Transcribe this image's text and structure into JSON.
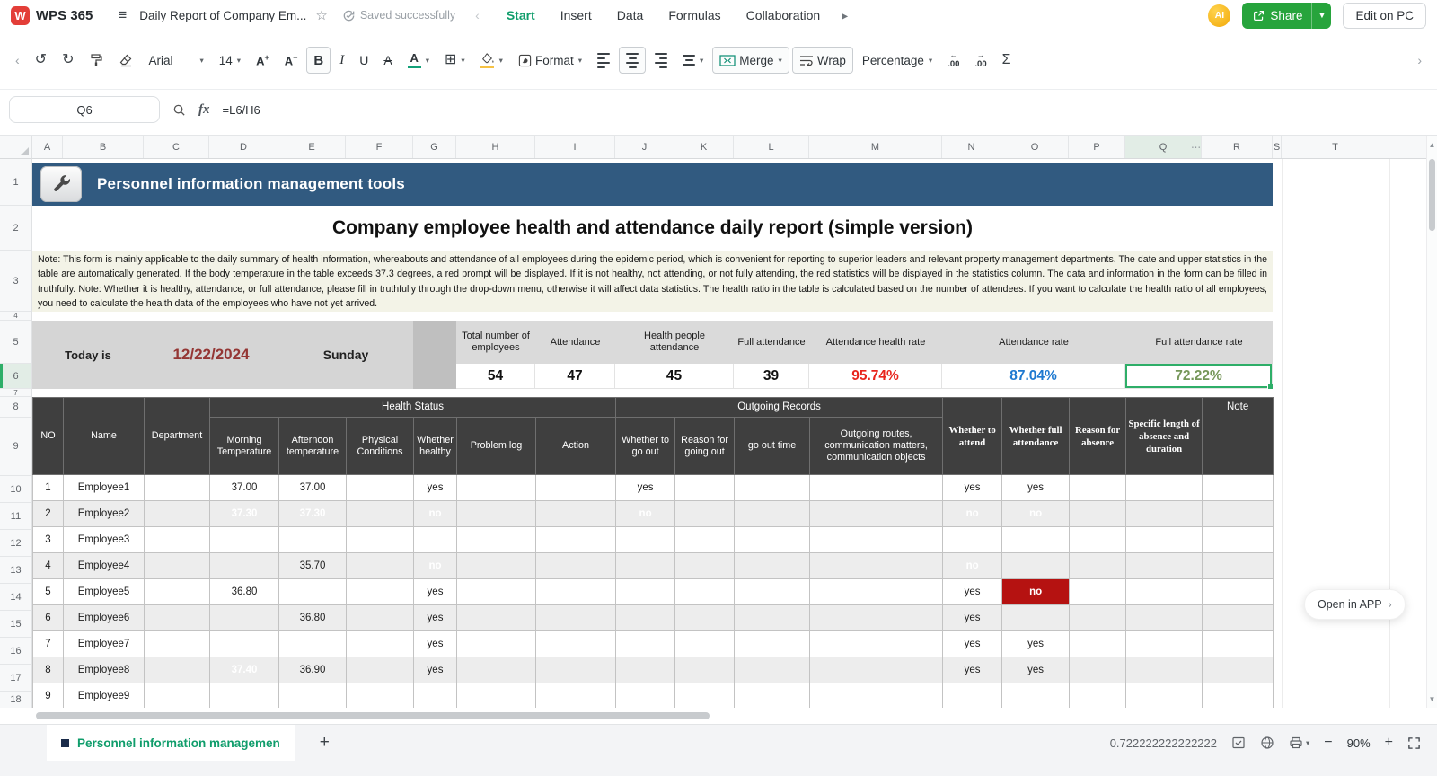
{
  "titlebar": {
    "app_name": "WPS 365",
    "doc_title": "Daily Report of Company Em...",
    "save_status": "Saved successfully",
    "menus": [
      "Start",
      "Insert",
      "Data",
      "Formulas",
      "Collaboration"
    ],
    "active_menu": "Start",
    "ai_badge": "AI",
    "share_label": "Share",
    "edit_on_pc_label": "Edit on PC"
  },
  "toolbar": {
    "font_name": "Arial",
    "font_size": "14",
    "bold_label": "B",
    "italic_label": "I",
    "underline_label": "U",
    "strikethrough_label": "A",
    "font_color_letter": "A",
    "format_label": "Format",
    "merge_label": "Merge",
    "wrap_label": "Wrap",
    "number_format": "Percentage",
    "increase_decimal": ".00",
    "decrease_decimal": ".00",
    "sum_label": "Σ"
  },
  "formula_bar": {
    "cell_ref": "Q6",
    "fx_label": "fx",
    "formula": "=L6/H6"
  },
  "grid": {
    "columns": [
      "A",
      "B",
      "C",
      "D",
      "E",
      "F",
      "G",
      "H",
      "I",
      "J",
      "K",
      "L",
      "M",
      "N",
      "O",
      "P",
      "Q",
      "R",
      "S",
      "T"
    ],
    "rows": [
      "1",
      "2",
      "3",
      "4",
      "5",
      "6",
      "7",
      "8",
      "9",
      "10",
      "11",
      "12",
      "13",
      "14",
      "15",
      "16",
      "17",
      "18"
    ],
    "selected_column": "Q",
    "selected_row": "6",
    "hidden_columns_indicator": "⋯"
  },
  "sheet": {
    "banner_title": "Personnel information management tools",
    "report_title": "Company employee health and attendance daily report (simple version)",
    "note": "Note: This form is mainly applicable to the daily summary of health information, whereabouts and attendance of all employees during the epidemic period, which is convenient for reporting to superior leaders and relevant property management departments. The date and upper statistics in the table are automatically generated. If the body temperature in the table exceeds 37.3 degrees, a red prompt will be displayed. If it is not healthy, not attending, or not fully attending, the red statistics will be displayed in the statistics column. The data and information in the form can be filled in truthfully. Note: Whether it is healthy, attendance, or full attendance, please fill in truthfully through the drop-down menu, otherwise it will affect data statistics. The health ratio in the table is calculated based on the number of attendees. If you want to calculate the health ratio of all employees, you need to calculate the health data of the employees who have not yet arrived.",
    "today_label": "Today is",
    "date": "12/22/2024",
    "weekday": "Sunday",
    "stats": [
      {
        "label": "Total number of employees",
        "value": "54"
      },
      {
        "label": "Attendance",
        "value": "47"
      },
      {
        "label": "Health people attendance",
        "value": "45"
      },
      {
        "label": "Full attendance",
        "value": "39"
      },
      {
        "label": "Attendance health rate",
        "value": "95.74%",
        "color": "#e8251d"
      },
      {
        "label": "Attendance rate",
        "value": "87.04%",
        "color": "#1e79d0"
      },
      {
        "label": "Full attendance rate",
        "value": "72.22%",
        "color": "#76975a",
        "selected": true
      }
    ],
    "table": {
      "corner_headers": {
        "no": "NO",
        "name": "Name",
        "dept": "Department"
      },
      "group_headers": {
        "health": "Health Status",
        "outgoing": "Outgoing Records",
        "note": "Note"
      },
      "sub_headers": [
        "Morning Temperature",
        "Afternoon temperature",
        "Physical Conditions",
        "Whether healthy",
        "Problem log",
        "Action",
        "Whether to go out",
        "Reason for going out",
        "go out time",
        "Outgoing routes, communication matters, communication objects"
      ],
      "tail_headers": [
        "Whether to attend",
        "Whether full attendance",
        "Reason for absence",
        "Specific length of absence and duration"
      ],
      "rows": [
        {
          "cells": [
            "1",
            "Employee1",
            "",
            "37.00",
            "37.00",
            "",
            "yes",
            "",
            "",
            "yes",
            "",
            "",
            "",
            "yes",
            "yes",
            "",
            "",
            ""
          ],
          "styles": {}
        },
        {
          "cells": [
            "2",
            "Employee2",
            "",
            "37.30",
            "37.30",
            "",
            "no",
            "",
            "",
            "no",
            "",
            "",
            "",
            "no",
            "no",
            "",
            "",
            ""
          ],
          "styles": {
            "3": "red",
            "4": "red",
            "6": "darkred",
            "9": "darkred",
            "13": "darkred",
            "14": "darkred"
          }
        },
        {
          "cells": [
            "3",
            "Employee3",
            "",
            "",
            "",
            "",
            "",
            "",
            "",
            "",
            "",
            "",
            "",
            "",
            "",
            "",
            "",
            ""
          ],
          "styles": {}
        },
        {
          "cells": [
            "4",
            "Employee4",
            "",
            "",
            "35.70",
            "",
            "no",
            "",
            "",
            "",
            "",
            "",
            "",
            "no",
            "",
            "",
            "",
            ""
          ],
          "styles": {
            "6": "darkred",
            "13": "darkred"
          }
        },
        {
          "cells": [
            "5",
            "Employee5",
            "",
            "36.80",
            "",
            "",
            "yes",
            "",
            "",
            "",
            "",
            "",
            "",
            "yes",
            "no",
            "",
            "",
            ""
          ],
          "styles": {
            "14": "darkred"
          }
        },
        {
          "cells": [
            "6",
            "Employee6",
            "",
            "",
            "36.80",
            "",
            "yes",
            "",
            "",
            "",
            "",
            "",
            "",
            "yes",
            "",
            "",
            "",
            ""
          ],
          "styles": {}
        },
        {
          "cells": [
            "7",
            "Employee7",
            "",
            "",
            "",
            "",
            "yes",
            "",
            "",
            "",
            "",
            "",
            "",
            "yes",
            "yes",
            "",
            "",
            ""
          ],
          "styles": {}
        },
        {
          "cells": [
            "8",
            "Employee8",
            "",
            "37.40",
            "36.90",
            "",
            "yes",
            "",
            "",
            "",
            "",
            "",
            "",
            "yes",
            "yes",
            "",
            "",
            ""
          ],
          "styles": {
            "3": "red"
          }
        },
        {
          "cells": [
            "9",
            "Employee9",
            "",
            "",
            "",
            "",
            "",
            "",
            "",
            "",
            "",
            "",
            "",
            "",
            "",
            "",
            "",
            ""
          ],
          "styles": {}
        }
      ]
    }
  },
  "statusbar": {
    "sheet_tab": "Personnel information managemen",
    "add_sheet": "+",
    "selection_value": "0.722222222222222",
    "zoom": "90%"
  },
  "floating": {
    "open_in_app": "Open in APP"
  },
  "colors": {
    "accent_green": "#2eae68",
    "menu_green": "#0f9d6b",
    "share_green": "#27a43c",
    "banner_blue": "#315a80",
    "note_bg": "#f3f3e7",
    "alert_red_bg": "#fe0000",
    "dark_red_bg": "#b51211",
    "rate_red": "#e8251d",
    "rate_blue": "#1e79d0",
    "rate_green": "#76975a",
    "date_maroon": "#943634",
    "table_header_dark": "#3f3f3f"
  }
}
